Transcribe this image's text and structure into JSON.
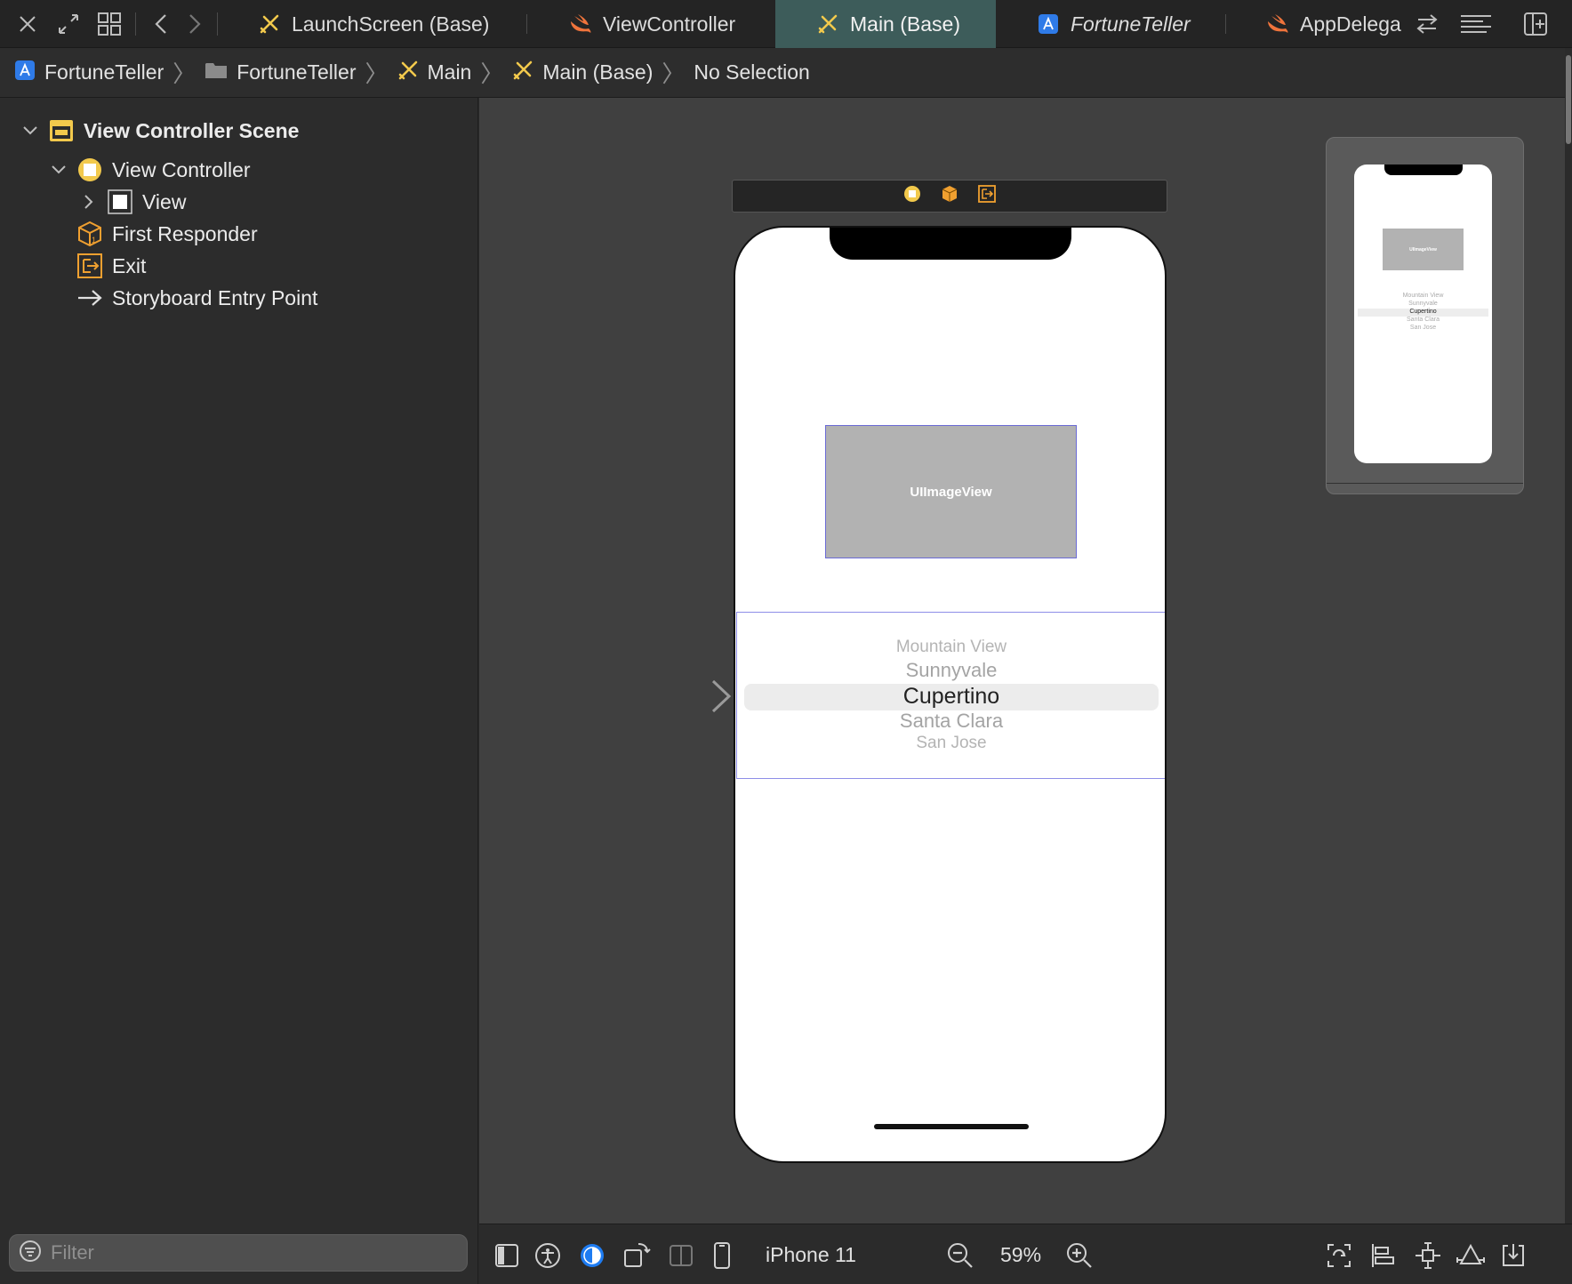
{
  "tabs": [
    {
      "label": "LaunchScreen (Base)",
      "icon": "storyboard-icon"
    },
    {
      "label": "ViewController",
      "icon": "swift-icon"
    },
    {
      "label": "Main (Base)",
      "icon": "storyboard-icon",
      "active": true
    },
    {
      "label": "FortuneTeller",
      "icon": "xcode-project-icon"
    },
    {
      "label": "AppDelega",
      "icon": "swift-icon"
    }
  ],
  "breadcrumb": [
    {
      "label": "FortuneTeller",
      "icon": "xcode-project-icon"
    },
    {
      "label": "FortuneTeller",
      "icon": "folder-icon"
    },
    {
      "label": "Main",
      "icon": "storyboard-icon"
    },
    {
      "label": "Main (Base)",
      "icon": "storyboard-icon"
    },
    {
      "label": "No Selection",
      "icon": ""
    }
  ],
  "outline": {
    "scene": "View Controller Scene",
    "view_controller": "View Controller",
    "view": "View",
    "first_responder": "First Responder",
    "exit": "Exit",
    "entry_point": "Storyboard Entry Point"
  },
  "filter": {
    "placeholder": "Filter"
  },
  "canvas": {
    "image_view_label": "UIImageView",
    "picker_items": [
      "Mountain View",
      "Sunnyvale",
      "Cupertino",
      "Santa Clara",
      "San Jose"
    ],
    "selected_picker_item": "Cupertino"
  },
  "minimap": {
    "image_view_label": "UIImageView",
    "picker_items": [
      "Mountain View",
      "Sunnyvale",
      "Cupertino",
      "Santa Clara",
      "San Jose"
    ]
  },
  "bottom_toolbar": {
    "device": "iPhone 11",
    "zoom": "59%"
  },
  "colors": {
    "active_tab": "#3d5c5a",
    "storyboard_yellow": "#f2c94c",
    "swift_orange": "#f0743c",
    "selection_blue": "#8e8ee8",
    "appearance_blue": "#1e7cf2"
  }
}
